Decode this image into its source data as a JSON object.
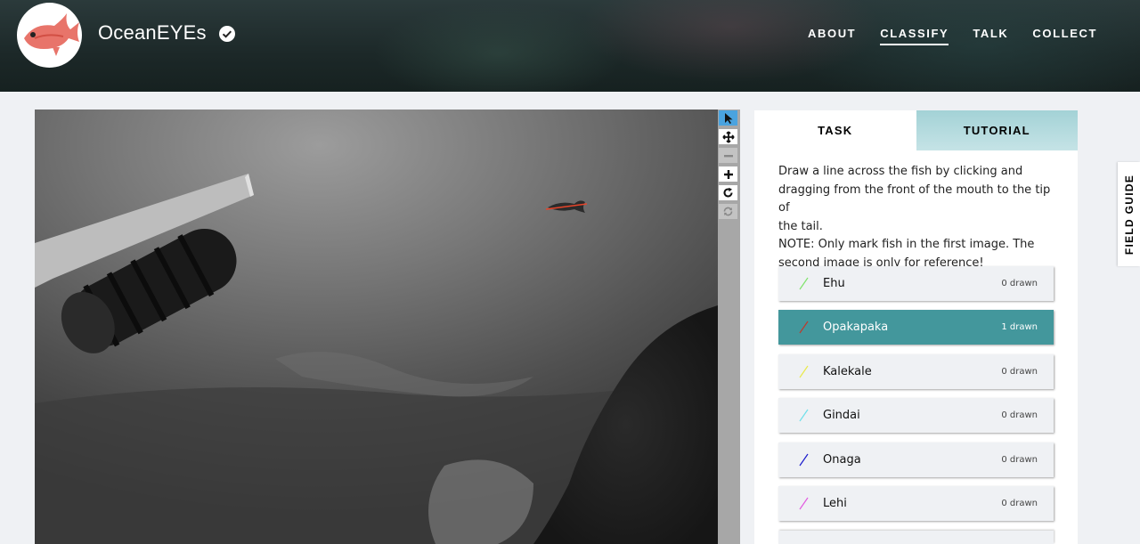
{
  "header": {
    "project_title": "OceanEYEs",
    "nav": [
      "ABOUT",
      "CLASSIFY",
      "TALK",
      "COLLECT"
    ],
    "active_nav": "CLASSIFY"
  },
  "viewer": {
    "tools": [
      "pointer-icon",
      "pan-icon",
      "zoom-out-icon",
      "zoom-in-icon",
      "rotate-icon",
      "reset-icon"
    ]
  },
  "task": {
    "tabs": [
      "TASK",
      "TUTORIAL"
    ],
    "instruction_lines": [
      "Draw a line across the fish by clicking and",
      "dragging from the front of the mouth to the tip of",
      "the tail.",
      "NOTE: Only mark fish in the first image. The",
      "second image is only for reference!"
    ],
    "species": [
      {
        "label": "Ehu",
        "count": "0 drawn",
        "color": "#7fe36b"
      },
      {
        "label": "Opakapaka",
        "count": "1 drawn",
        "color": "#c0392b"
      },
      {
        "label": "Kalekale",
        "count": "0 drawn",
        "color": "#e9e94a"
      },
      {
        "label": "Gindai",
        "count": "0 drawn",
        "color": "#6fe0ea"
      },
      {
        "label": "Onaga",
        "count": "0 drawn",
        "color": "#1a1acc"
      },
      {
        "label": "Lehi",
        "count": "0 drawn",
        "color": "#e25be0"
      }
    ],
    "selected": "Opakapaka"
  },
  "field_guide_label": "FIELD GUIDE",
  "colors": {
    "accent": "#43979c",
    "tutorial_tab": "#a3d2d6",
    "mark_line": "#e8452a"
  }
}
